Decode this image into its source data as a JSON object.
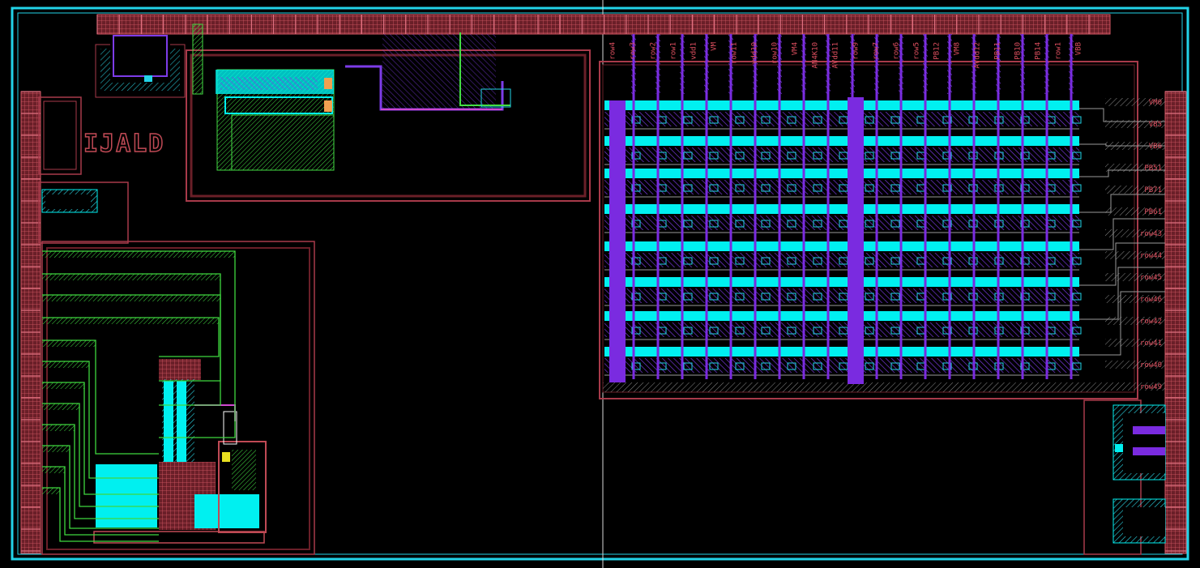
{
  "logo": "IJALD",
  "colors": {
    "background": "#000000",
    "border": "#22d3e8",
    "pad": "#a83a4a",
    "metal_cyan": "#00f0f0",
    "metal_violet": "#7a2be0",
    "metal_green": "#3fd83f",
    "well_red": "#8c2a2a"
  },
  "top_pins": [
    "row4",
    "row3",
    "row2",
    "row1",
    "vdd1",
    "VM",
    "row11",
    "vdd10",
    "row10",
    "VM4",
    "AN4K10",
    "AVdd11",
    "row9",
    "row7",
    "row6",
    "row5",
    "PB12",
    "VM8",
    "AVdd12",
    "PB11",
    "PB10",
    "PB14",
    "row1",
    "VBB"
  ],
  "right_pins": [
    "VM0",
    "VB5",
    "VB6",
    "PB51",
    "PB71",
    "PB61",
    "row43",
    "row44",
    "row45",
    "row46",
    "row42",
    "row41",
    "row40",
    "row49"
  ]
}
